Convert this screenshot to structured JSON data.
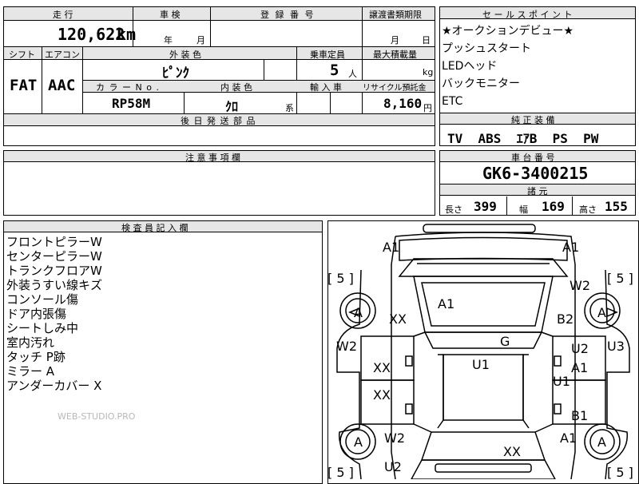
{
  "mileage": {
    "label": "走 行",
    "value": "120,622",
    "unit": "km"
  },
  "inspection": {
    "label": "車 検",
    "year_unit": "年",
    "month_unit": "月"
  },
  "registration": {
    "label": "登 録 番 号"
  },
  "transfer": {
    "label": "譲渡書類期限",
    "month_unit": "月",
    "day_unit": "日"
  },
  "shift": {
    "label": "シフト",
    "value": "FAT"
  },
  "aircon": {
    "label": "エアコン",
    "value": "AAC"
  },
  "exterior_color": {
    "label": "外 装 色",
    "value": "ﾋﾟﾝｸ"
  },
  "capacity": {
    "label": "乗車定員",
    "value": "5",
    "unit": "人"
  },
  "max_load": {
    "label": "最大積載量",
    "unit": "kg"
  },
  "color_no": {
    "label": "カ ラ ー N o .",
    "value": "RP58M"
  },
  "interior_color": {
    "label": "内 装 色",
    "value": "ｸﾛ",
    "unit": "系"
  },
  "import_car": {
    "label": "輸 入 車"
  },
  "recycle": {
    "label": "リサイクル預託金",
    "value": "8,160",
    "unit": "円"
  },
  "later_parts": {
    "label": "後 日 発 送 部 品"
  },
  "notes": {
    "label": "注 意 事 項 欄"
  },
  "sales_points": {
    "label": "セ ー ル ス ポ イ ン ト",
    "items": [
      "★オークションデビュー★",
      "プッシュスタート",
      "LEDヘッド",
      "バックモニター",
      "ETC"
    ]
  },
  "standard_equipment": {
    "label": "純 正 装 備",
    "value": "TV  ABS  ｴｱB  PS  PW"
  },
  "chassis": {
    "label": "車 台 番 号",
    "value": "GK6-3400215"
  },
  "specs": {
    "label": "諸 元",
    "length_label": "長さ",
    "length": "399",
    "width_label": "幅",
    "width": "169",
    "height_label": "高さ",
    "height": "155"
  },
  "inspector": {
    "label": "検 査 員 記 入 欄",
    "lines": [
      "フロントピラーW",
      "センターピラーW",
      "トランクフロアW",
      "外装うすい線キズ",
      "コンソール傷",
      "ドア内張傷",
      "シートしみ中",
      "室内汚れ",
      "タッチ P跡",
      "ミラー A",
      "アンダーカバー X"
    ]
  },
  "watermark": "WEB-STUDIO.PRO",
  "diagram": {
    "tl": "A1",
    "tr": "A1",
    "br_fl": "[ 5 ]",
    "br_fr": "[ 5 ]",
    "br_rl": "[ 5 ]",
    "br_rr": "[ 5 ]",
    "w2_top": "W2",
    "a1_hood": "A1",
    "xx_front": "XX",
    "b2": "B2",
    "g": "G",
    "w2_left": "W2",
    "u2_right": "U2",
    "u3": "U3",
    "xx_left1": "XX",
    "u1_center": "U1",
    "a1_right": "A1",
    "u1_right": "U1",
    "xx_left2": "XX",
    "b1": "B1",
    "w2_bottom": "W2",
    "a1_bottom": "A1",
    "xx_rear": "XX",
    "u2_bottom": "U2",
    "tire_fl": "A",
    "tire_fr": "A",
    "tire_rl": "A",
    "tire_rr": "A"
  }
}
